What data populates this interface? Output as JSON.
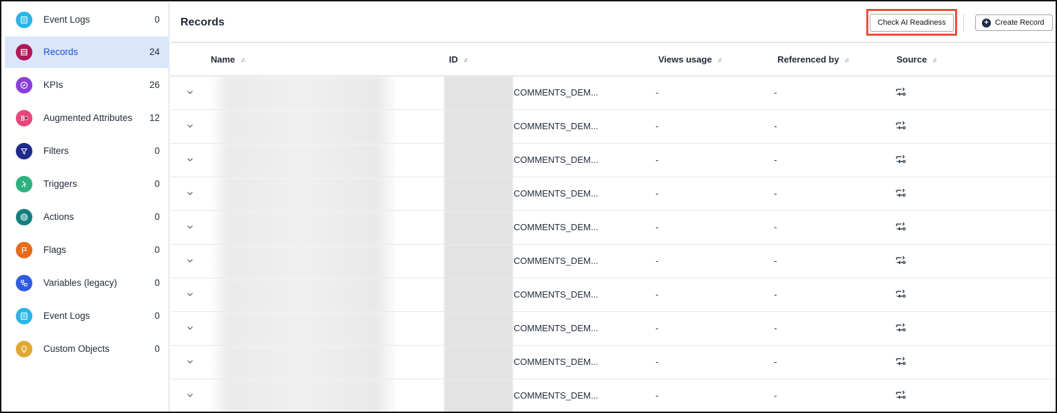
{
  "sidebar": {
    "items": [
      {
        "label": "Event Logs",
        "count": "0",
        "icon": "event-logs-icon",
        "color": "#29b6e8",
        "active": false
      },
      {
        "label": "Records",
        "count": "24",
        "icon": "records-icon",
        "color": "#b0175a",
        "active": true
      },
      {
        "label": "KPIs",
        "count": "26",
        "icon": "compass-icon",
        "color": "#8b3fd9",
        "active": false
      },
      {
        "label": "Augmented Attributes",
        "count": "12",
        "icon": "augmented-attributes-icon",
        "color": "#e8457d",
        "active": false
      },
      {
        "label": "Filters",
        "count": "0",
        "icon": "filter-icon",
        "color": "#1e2a8a",
        "active": false
      },
      {
        "label": "Triggers",
        "count": "0",
        "icon": "trigger-icon",
        "color": "#2fb07f",
        "active": false
      },
      {
        "label": "Actions",
        "count": "0",
        "icon": "actions-icon",
        "color": "#137f7f",
        "active": false
      },
      {
        "label": "Flags",
        "count": "0",
        "icon": "flag-icon",
        "color": "#e86a1a",
        "active": false
      },
      {
        "label": "Variables (legacy)",
        "count": "0",
        "icon": "variables-icon",
        "color": "#2f5be0",
        "active": false
      },
      {
        "label": "Event Logs",
        "count": "0",
        "icon": "event-logs-icon",
        "color": "#29b6e8",
        "active": false
      },
      {
        "label": "Custom Objects",
        "count": "0",
        "icon": "lightbulb-icon",
        "color": "#e0a830",
        "active": false
      }
    ]
  },
  "header": {
    "title": "Records",
    "check_button": "Check AI Readiness",
    "create_button": "Create Record",
    "highlight_color": "#e8503a"
  },
  "table": {
    "columns": [
      {
        "label": "Name",
        "sort_icon": "sort-icon"
      },
      {
        "label": "ID",
        "sort_icon": "sort-icon"
      },
      {
        "label": "Views usage",
        "sort_icon": "sort-icon"
      },
      {
        "label": "Referenced by",
        "sort_icon": "sort-icon"
      },
      {
        "label": "Source",
        "sort_icon": "sort-icon"
      }
    ],
    "rows": [
      {
        "id": "COMMENTS_DEM...",
        "views": "-",
        "referenced": "-",
        "source_icon": "source-icon"
      },
      {
        "id": "COMMENTS_DEM...",
        "views": "-",
        "referenced": "-",
        "source_icon": "source-icon"
      },
      {
        "id": "COMMENTS_DEM...",
        "views": "-",
        "referenced": "-",
        "source_icon": "source-icon"
      },
      {
        "id": "COMMENTS_DEM...",
        "views": "-",
        "referenced": "-",
        "source_icon": "source-icon"
      },
      {
        "id": "COMMENTS_DEM...",
        "views": "-",
        "referenced": "-",
        "source_icon": "source-icon"
      },
      {
        "id": "COMMENTS_DEM...",
        "views": "-",
        "referenced": "-",
        "source_icon": "source-icon"
      },
      {
        "id": "COMMENTS_DEM...",
        "views": "-",
        "referenced": "-",
        "source_icon": "source-icon"
      },
      {
        "id": "COMMENTS_DEM...",
        "views": "-",
        "referenced": "-",
        "source_icon": "source-icon"
      },
      {
        "id": "COMMENTS_DEM...",
        "views": "-",
        "referenced": "-",
        "source_icon": "source-icon"
      },
      {
        "id": "COMMENTS_DEM...",
        "views": "-",
        "referenced": "-",
        "source_icon": "source-icon"
      }
    ]
  }
}
